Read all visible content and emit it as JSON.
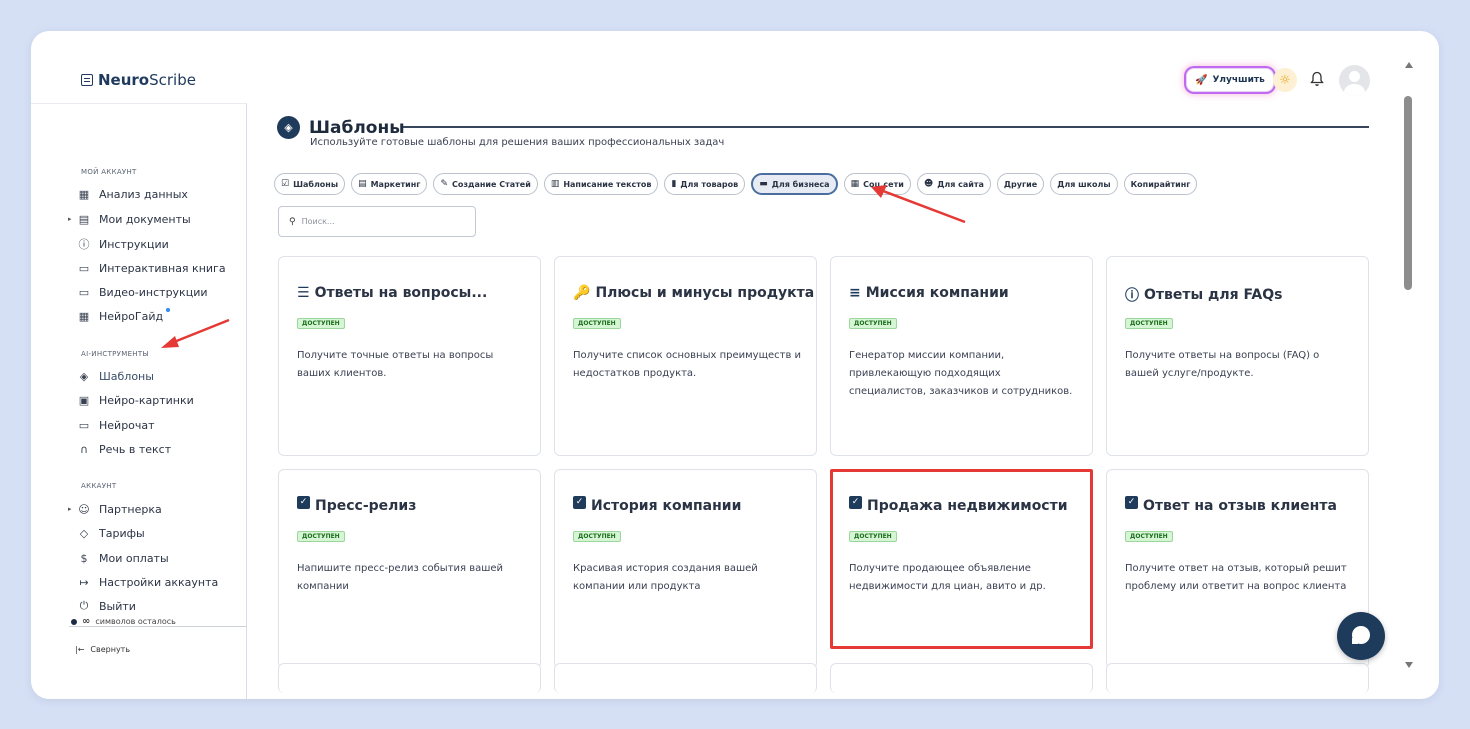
{
  "header": {
    "logo_bold": "Neuro",
    "logo_rest": "Scribe",
    "upgrade_label": "Улучшить"
  },
  "sidebar": {
    "section_account": "МОЙ АККАУНТ",
    "account_items": [
      {
        "label": "Анализ данных",
        "icon": "grid-icon"
      },
      {
        "label": "Мои документы",
        "icon": "document-icon"
      },
      {
        "label": "Инструкции",
        "icon": "help-icon"
      },
      {
        "label": "Интерактивная книга",
        "icon": "book-icon"
      },
      {
        "label": "Видео-инструкции",
        "icon": "video-icon"
      },
      {
        "label": "НейроГайд",
        "icon": "table-icon"
      }
    ],
    "section_ai": "AI-ИНСТРУМЕНТЫ",
    "ai_items": [
      {
        "label": "Шаблоны",
        "icon": "layers-icon"
      },
      {
        "label": "Нейро-картинки",
        "icon": "image-icon"
      },
      {
        "label": "Нейрочат",
        "icon": "chat-icon"
      },
      {
        "label": "Речь в текст",
        "icon": "headphones-icon"
      }
    ],
    "section_acc": "АККАУНТ",
    "acc_items": [
      {
        "label": "Партнерка",
        "icon": "users-icon"
      },
      {
        "label": "Тарифы",
        "icon": "tag-icon"
      },
      {
        "label": "Мои оплаты",
        "icon": "dollar-icon"
      },
      {
        "label": "Настройки аккаунта",
        "icon": "login-icon"
      },
      {
        "label": "Выйти",
        "icon": "power-icon"
      }
    ],
    "credits_symbol": "∞",
    "credits_text": "символов осталось",
    "collapse_label": "Свернуть"
  },
  "main": {
    "title": "Шаблоны",
    "subtitle": "Используйте готовые шаблоны для решения ваших профессиональных задач",
    "filters": [
      {
        "label": "Шаблоны",
        "icon": "☑"
      },
      {
        "label": "Маркетинг",
        "icon": "▤"
      },
      {
        "label": "Создание Статей",
        "icon": "✎"
      },
      {
        "label": "Написание текстов",
        "icon": "▥"
      },
      {
        "label": "Для товаров",
        "icon": "▮"
      },
      {
        "label": "Для бизнеса",
        "icon": "▬"
      },
      {
        "label": "Соц.сети",
        "icon": "▦"
      },
      {
        "label": "Для сайта",
        "icon": "☻"
      },
      {
        "label": "Другие",
        "icon": ""
      },
      {
        "label": "Для школы",
        "icon": ""
      },
      {
        "label": "Копирайтинг",
        "icon": ""
      }
    ],
    "active_filter": "Для бизнеса",
    "search_placeholder": "Поиск...",
    "badge_label": "ДОСТУПЕН",
    "cards": [
      {
        "title": "Ответы на вопросы...",
        "icon": "☰",
        "desc": "Получите точные ответы на вопросы ваших клиентов."
      },
      {
        "title": "Плюсы и минусы продукта",
        "icon": "🔑",
        "desc": "Получите список основных преимуществ и недостатков продукта."
      },
      {
        "title": "Миссия компании",
        "icon": "≡",
        "desc": "Генератор миссии компании, привлекающую подходящих специалистов, заказчиков и сотрудников."
      },
      {
        "title": "Ответы для FAQs",
        "icon": "ⓘ",
        "desc": "Получите ответы на вопросы (FAQ) о вашей услуге/продукте."
      },
      {
        "title": "Пресс-релиз",
        "icon": "✓",
        "desc": "Напишите пресс-релиз события вашей компании"
      },
      {
        "title": "История компании",
        "icon": "✓",
        "desc": "Красивая история создания вашей компании или продукта"
      },
      {
        "title": "Продажа недвижимости",
        "icon": "✓",
        "desc": "Получите продающее объявление недвижимости для циан, авито и др."
      },
      {
        "title": "Ответ на отзыв клиента",
        "icon": "✓",
        "desc": "Получите ответ на отзыв, который решит проблему или ответит на вопрос клиента"
      }
    ]
  },
  "colors": {
    "accent": "#1f3b5c",
    "highlight": "#e53935",
    "badge_bg": "#d5f5d5"
  }
}
